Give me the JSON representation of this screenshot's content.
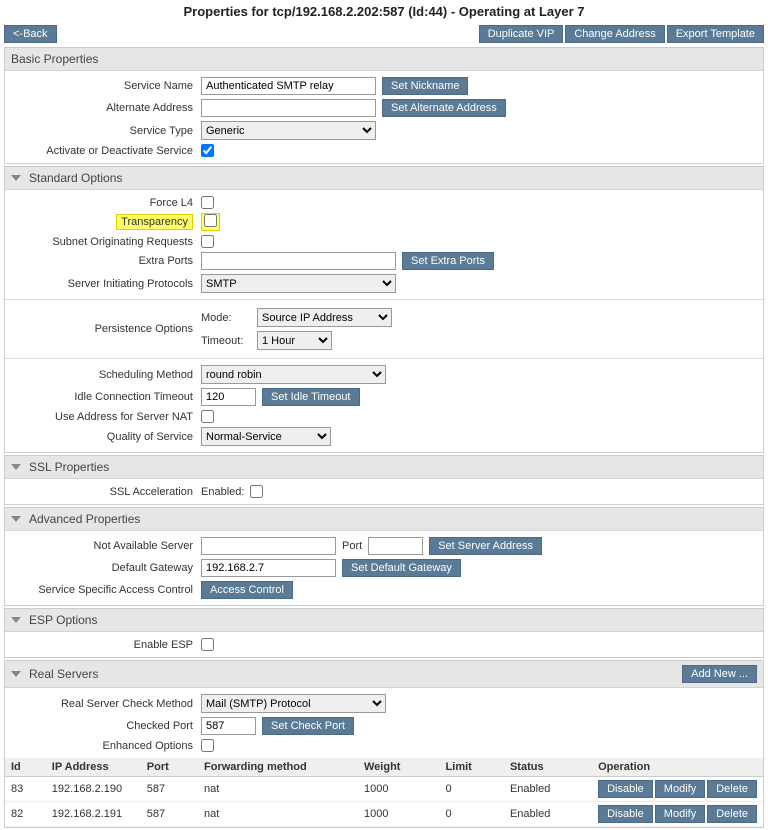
{
  "title": "Properties for tcp/192.168.2.202:587 (Id:44) - Operating at Layer 7",
  "top": {
    "back": "<-Back",
    "duplicate": "Duplicate VIP",
    "change_addr": "Change Address",
    "export": "Export Template"
  },
  "basic": {
    "heading": "Basic Properties",
    "service_name_label": "Service Name",
    "service_name_value": "Authenticated SMTP relay",
    "set_nickname": "Set Nickname",
    "alt_addr_label": "Alternate Address",
    "alt_addr_value": "",
    "set_alt_addr": "Set Alternate Address",
    "service_type_label": "Service Type",
    "service_type_value": "Generic",
    "activate_label": "Activate or Deactivate Service"
  },
  "standard": {
    "heading": "Standard Options",
    "force_l4_label": "Force L4",
    "transparency_label": "Transparency",
    "subnet_label": "Subnet Originating Requests",
    "extra_ports_label": "Extra Ports",
    "extra_ports_value": "",
    "set_extra_ports": "Set Extra Ports",
    "server_init_label": "Server Initiating Protocols",
    "server_init_value": "SMTP",
    "persistence_label": "Persistence Options",
    "mode_label": "Mode:",
    "mode_value": "Source IP Address",
    "timeout_label": "Timeout:",
    "timeout_value": "1 Hour",
    "scheduling_label": "Scheduling Method",
    "scheduling_value": "round robin",
    "idle_label": "Idle Connection Timeout",
    "idle_value": "120",
    "set_idle": "Set Idle Timeout",
    "nat_label": "Use Address for Server NAT",
    "qos_label": "Quality of Service",
    "qos_value": "Normal-Service"
  },
  "ssl": {
    "heading": "SSL Properties",
    "accel_label": "SSL Acceleration",
    "enabled_label": "Enabled:"
  },
  "advanced": {
    "heading": "Advanced Properties",
    "na_server_label": "Not Available Server",
    "na_server_value": "",
    "port_label": "Port",
    "port_value": "",
    "set_server_addr": "Set Server Address",
    "gateway_label": "Default Gateway",
    "gateway_value": "192.168.2.7",
    "set_gateway": "Set Default Gateway",
    "acl_label": "Service Specific Access Control",
    "acl_btn": "Access Control"
  },
  "esp": {
    "heading": "ESP Options",
    "enable_label": "Enable ESP"
  },
  "real": {
    "heading": "Real Servers",
    "add_new": "Add New ...",
    "check_method_label": "Real Server Check Method",
    "check_method_value": "Mail (SMTP) Protocol",
    "checked_port_label": "Checked Port",
    "checked_port_value": "587",
    "set_check_port": "Set Check Port",
    "enhanced_label": "Enhanced Options",
    "cols": {
      "id": "Id",
      "ip": "IP Address",
      "port": "Port",
      "fwd": "Forwarding method",
      "weight": "Weight",
      "limit": "Limit",
      "status": "Status",
      "op": "Operation"
    },
    "rows": [
      {
        "id": "83",
        "ip": "192.168.2.190",
        "port": "587",
        "fwd": "nat",
        "weight": "1000",
        "limit": "0",
        "status": "Enabled"
      },
      {
        "id": "82",
        "ip": "192.168.2.191",
        "port": "587",
        "fwd": "nat",
        "weight": "1000",
        "limit": "0",
        "status": "Enabled"
      }
    ],
    "ops": {
      "disable": "Disable",
      "modify": "Modify",
      "delete": "Delete"
    }
  }
}
